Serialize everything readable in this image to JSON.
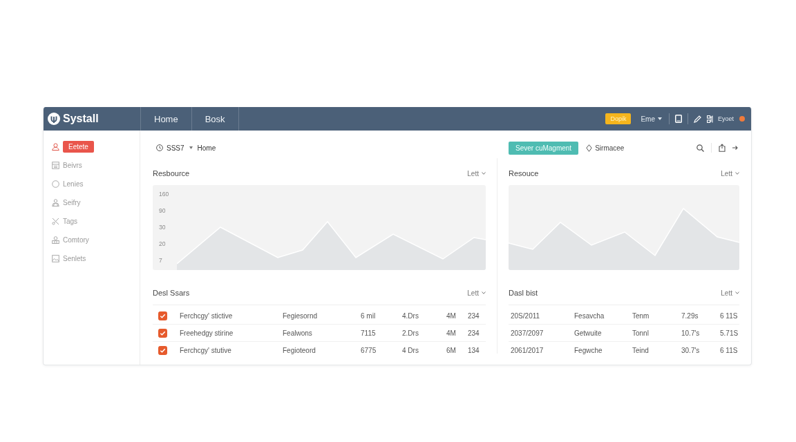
{
  "header": {
    "logo": "Systall",
    "nav": [
      "Home",
      "Bosk"
    ],
    "badge": "Dopik",
    "menu": "Eme",
    "user": "Eyoet"
  },
  "sidebar": {
    "items": [
      {
        "label": "Eetete",
        "selected": true
      },
      {
        "label": "Beivrs",
        "selected": false
      },
      {
        "label": "Lenies",
        "selected": false
      },
      {
        "label": "Seifry",
        "selected": false
      },
      {
        "label": "Tags",
        "selected": false
      },
      {
        "label": "Comtory",
        "selected": false
      },
      {
        "label": "Senlets",
        "selected": false
      }
    ]
  },
  "toolbar": {
    "breadcrumb": [
      "SSS7",
      "Home"
    ],
    "action_button": "Sever cuMagment",
    "location": "Sirmacee"
  },
  "columns": [
    {
      "panel": {
        "title": "Resbource",
        "menu": "Lett",
        "axis_labels": [
          "160",
          "90",
          "30",
          "20",
          "7"
        ]
      },
      "table": {
        "title": "Desl Ssars",
        "menu": "Lett",
        "rows": [
          {
            "checked": true,
            "cells": [
              "Ferchcgy' stictive",
              "Fegiesornd",
              "6 mil",
              "4.Drs",
              "4M",
              "234"
            ]
          },
          {
            "checked": true,
            "cells": [
              "Freehedgy stirine",
              "Fealwons",
              "7115",
              "2.Drs",
              "4M",
              "234"
            ]
          },
          {
            "checked": true,
            "cells": [
              "Ferchcgy' stutive",
              "Fegioteord",
              "6775",
              "4 Drs",
              "6M",
              "134"
            ]
          }
        ]
      }
    },
    {
      "panel": {
        "title": "Resouce",
        "menu": "Lett"
      },
      "table": {
        "title": "Dasl bist",
        "menu": "Lett",
        "rows": [
          {
            "cells": [
              "20S/2011",
              "Fesavcha",
              "Tenm",
              "7.29s",
              "6 11S"
            ]
          },
          {
            "cells": [
              "2037/2097",
              "Getwuite",
              "Tonnl",
              "10.7's",
              "5.71S"
            ]
          },
          {
            "cells": [
              "2061/2017",
              "Fegwche",
              "Teind",
              "30.7's",
              "6 11S"
            ]
          }
        ]
      }
    }
  ]
}
